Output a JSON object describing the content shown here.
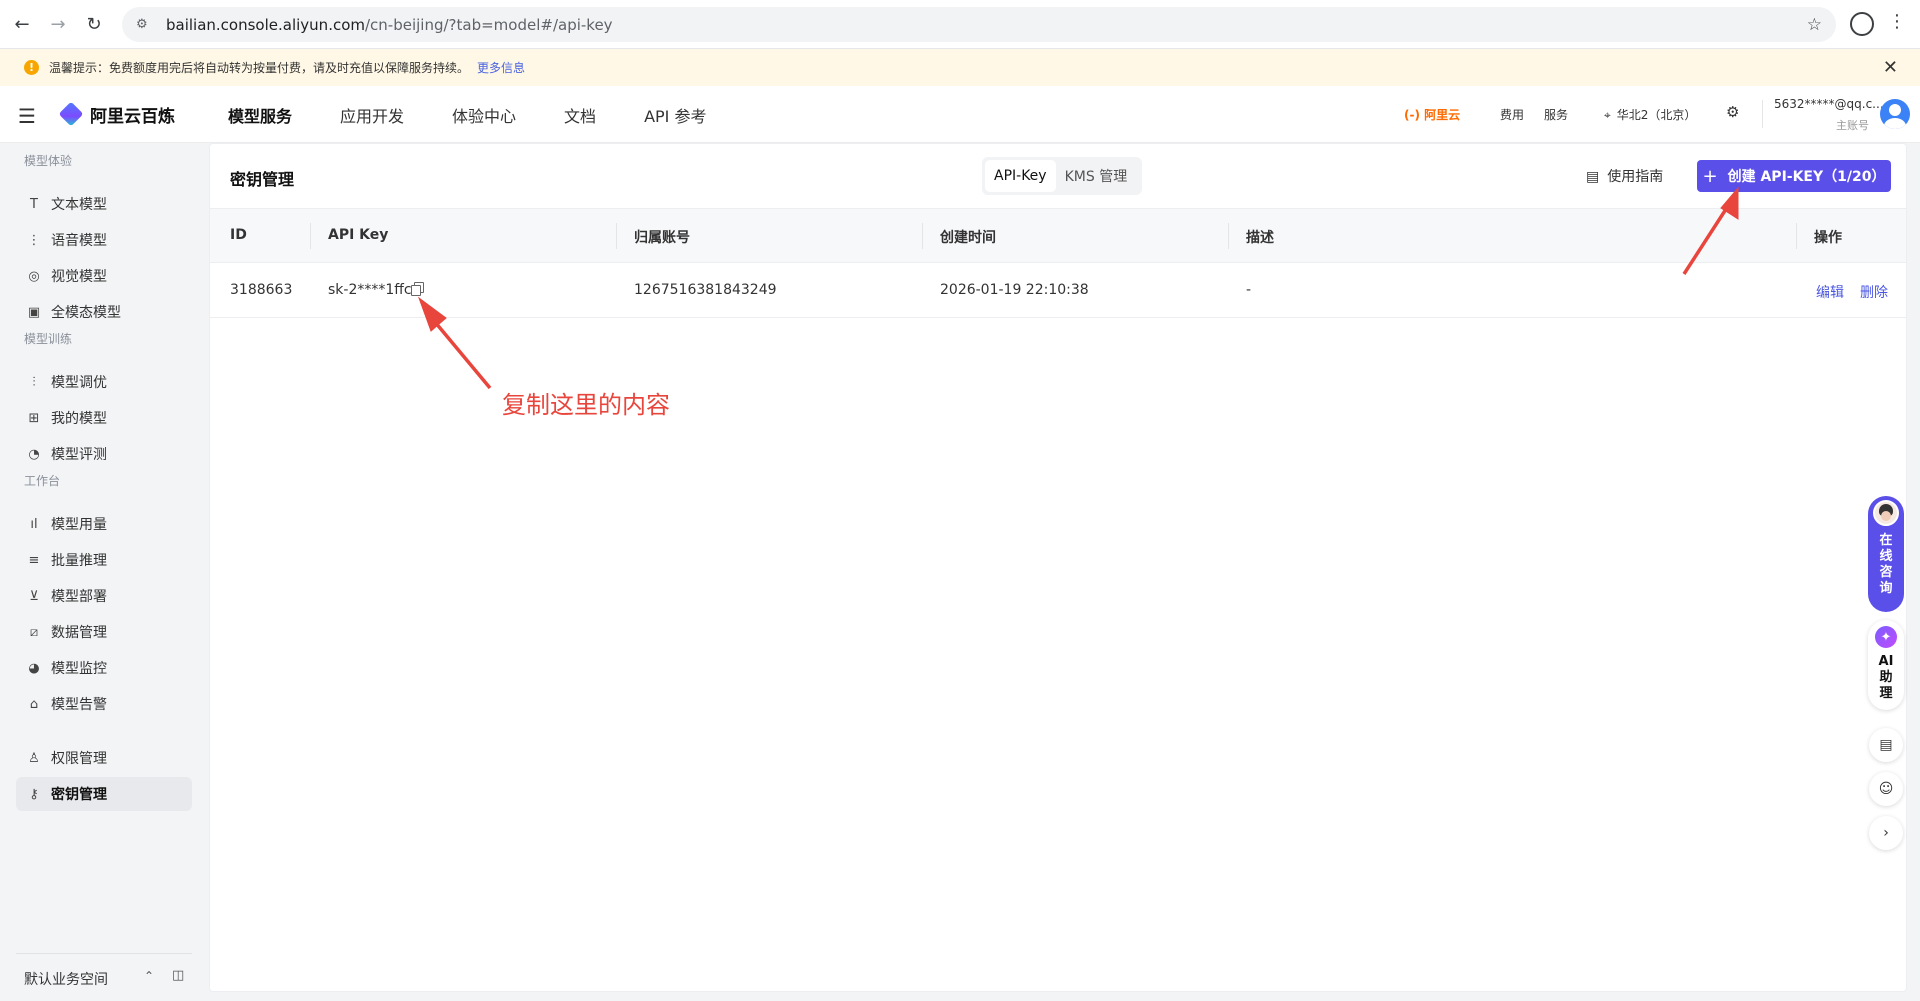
{
  "browser": {
    "url_host": "bailian.console.aliyun.com",
    "url_path": "/cn-beijing/?tab=model#/api-key"
  },
  "notice": {
    "text": "温馨提示：免费额度用完后将自动转为按量付费，请及时充值以保障服务持续。",
    "link": "更多信息"
  },
  "header": {
    "brand": "阿里云百炼",
    "nav": [
      "模型服务",
      "应用开发",
      "体验中心",
      "文档",
      "API 参考"
    ],
    "aliyun_label": "阿里云",
    "fee": "费用",
    "service": "服务",
    "region": "华北2（北京）",
    "account_name": "5632*****@qq.c...",
    "account_role": "主账号"
  },
  "sidebar": {
    "groups": {
      "experience": "模型体验",
      "training": "模型训练",
      "workbench": "工作台"
    },
    "items": [
      {
        "label": "文本模型",
        "icon": "T"
      },
      {
        "label": "语音模型",
        "icon": "⋮"
      },
      {
        "label": "视觉模型",
        "icon": "◎"
      },
      {
        "label": "全模态模型",
        "icon": "▣"
      },
      {
        "label": "模型调优",
        "icon": "⫶"
      },
      {
        "label": "我的模型",
        "icon": "⊞"
      },
      {
        "label": "模型评测",
        "icon": "◔"
      },
      {
        "label": "模型用量",
        "icon": "ıl"
      },
      {
        "label": "批量推理",
        "icon": "≡"
      },
      {
        "label": "模型部署",
        "icon": "⊻"
      },
      {
        "label": "数据管理",
        "icon": "⧄"
      },
      {
        "label": "模型监控",
        "icon": "◕"
      },
      {
        "label": "模型告警",
        "icon": "⌂"
      },
      {
        "label": "权限管理",
        "icon": "♙"
      },
      {
        "label": "密钥管理",
        "icon": "⚷"
      }
    ],
    "workspace": "默认业务空间"
  },
  "main": {
    "title": "密钥管理",
    "tabs": [
      "API-Key",
      "KMS 管理"
    ],
    "guide": "使用指南",
    "create_button": "创建 API-KEY（1/20）",
    "columns": [
      "ID",
      "API Key",
      "归属账号",
      "创建时间",
      "描述",
      "操作"
    ],
    "rows": [
      {
        "id": "3188663",
        "api_key": "sk-2****1ffc",
        "account": "1267516381843249",
        "created": "2026-01-19 22:10:38",
        "desc": "-",
        "edit": "编辑",
        "delete": "删除"
      }
    ]
  },
  "annotation": {
    "text": "复制这里的内容",
    "color": "#e8453c"
  },
  "dock": {
    "chat": "在线咨询",
    "ai": "AI助理"
  },
  "colors": {
    "primary": "#5b4fe9",
    "link": "#4a56e2",
    "aliyun": "#ff6a00"
  }
}
